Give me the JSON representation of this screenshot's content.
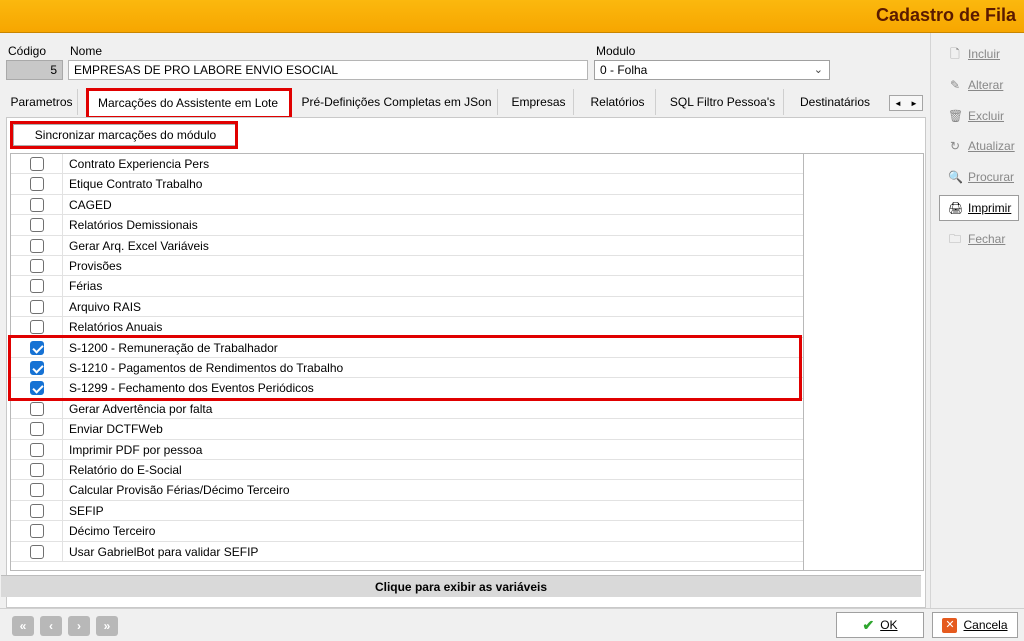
{
  "window": {
    "title": "Cadastro de Fila"
  },
  "header": {
    "codigo_label": "Código",
    "codigo_value": "5",
    "nome_label": "Nome",
    "nome_value": "EMPRESAS DE PRO LABORE ENVIO ESOCIAL",
    "modulo_label": "Modulo",
    "modulo_value": "0 - Folha"
  },
  "tabs": [
    {
      "label": "Parametros"
    },
    {
      "label": "Marcações do Assistente em Lote"
    },
    {
      "label": "Pré-Definições Completas em JSon"
    },
    {
      "label": "Empresas"
    },
    {
      "label": "Relatórios"
    },
    {
      "label": "SQL Filtro Pessoa's"
    },
    {
      "label": "Destinatários"
    }
  ],
  "tab_scroll": {
    "left": "◄",
    "right": "►"
  },
  "sync_button": "Sincronizar marcações do módulo",
  "items": [
    {
      "label": "Contrato Experiencia Pers",
      "checked": false
    },
    {
      "label": "Etique Contrato Trabalho",
      "checked": false
    },
    {
      "label": "CAGED",
      "checked": false
    },
    {
      "label": "Relatórios Demissionais",
      "checked": false
    },
    {
      "label": "Gerar Arq. Excel Variáveis",
      "checked": false
    },
    {
      "label": "Provisões",
      "checked": false
    },
    {
      "label": "Férias",
      "checked": false
    },
    {
      "label": "Arquivo RAIS",
      "checked": false
    },
    {
      "label": "Relatórios Anuais",
      "checked": false
    },
    {
      "label": "S-1200 - Remuneração de Trabalhador",
      "checked": true
    },
    {
      "label": "S-1210 - Pagamentos de Rendimentos do Trabalho",
      "checked": true
    },
    {
      "label": "S-1299 - Fechamento dos Eventos Periódicos",
      "checked": true
    },
    {
      "label": "Gerar Advertência por falta",
      "checked": false
    },
    {
      "label": "Enviar DCTFWeb",
      "checked": false
    },
    {
      "label": "Imprimir PDF por pessoa",
      "checked": false
    },
    {
      "label": "Relatório do E-Social",
      "checked": false
    },
    {
      "label": "Calcular Provisão Férias/Décimo Terceiro",
      "checked": false
    },
    {
      "label": "SEFIP",
      "checked": false
    },
    {
      "label": "Décimo Terceiro",
      "checked": false
    },
    {
      "label": "Usar GabrielBot para validar SEFIP",
      "checked": false
    }
  ],
  "footer_bar": "Clique para exibir as variáveis",
  "sidebar": [
    {
      "label": "Incluir",
      "icon": "document-icon",
      "enabled": false
    },
    {
      "label": "Alterar",
      "icon": "pencil-icon",
      "enabled": false
    },
    {
      "label": "Excluir",
      "icon": "trash-icon",
      "enabled": false
    },
    {
      "label": "Atualizar",
      "icon": "refresh-icon",
      "enabled": false
    },
    {
      "label": "Procurar",
      "icon": "binoculars-icon",
      "enabled": false
    },
    {
      "label": "Imprimir",
      "icon": "printer-icon",
      "enabled": true
    },
    {
      "label": "Fechar",
      "icon": "folder-icon",
      "enabled": false
    }
  ],
  "bottom": {
    "nav": [
      "first",
      "prev",
      "next",
      "last"
    ],
    "ok_label": "OK",
    "cancel_label": "Cancela"
  },
  "colors": {
    "title_bar": "#f7a600",
    "highlight": "#e00000",
    "checkbox_checked": "#1672d4"
  }
}
